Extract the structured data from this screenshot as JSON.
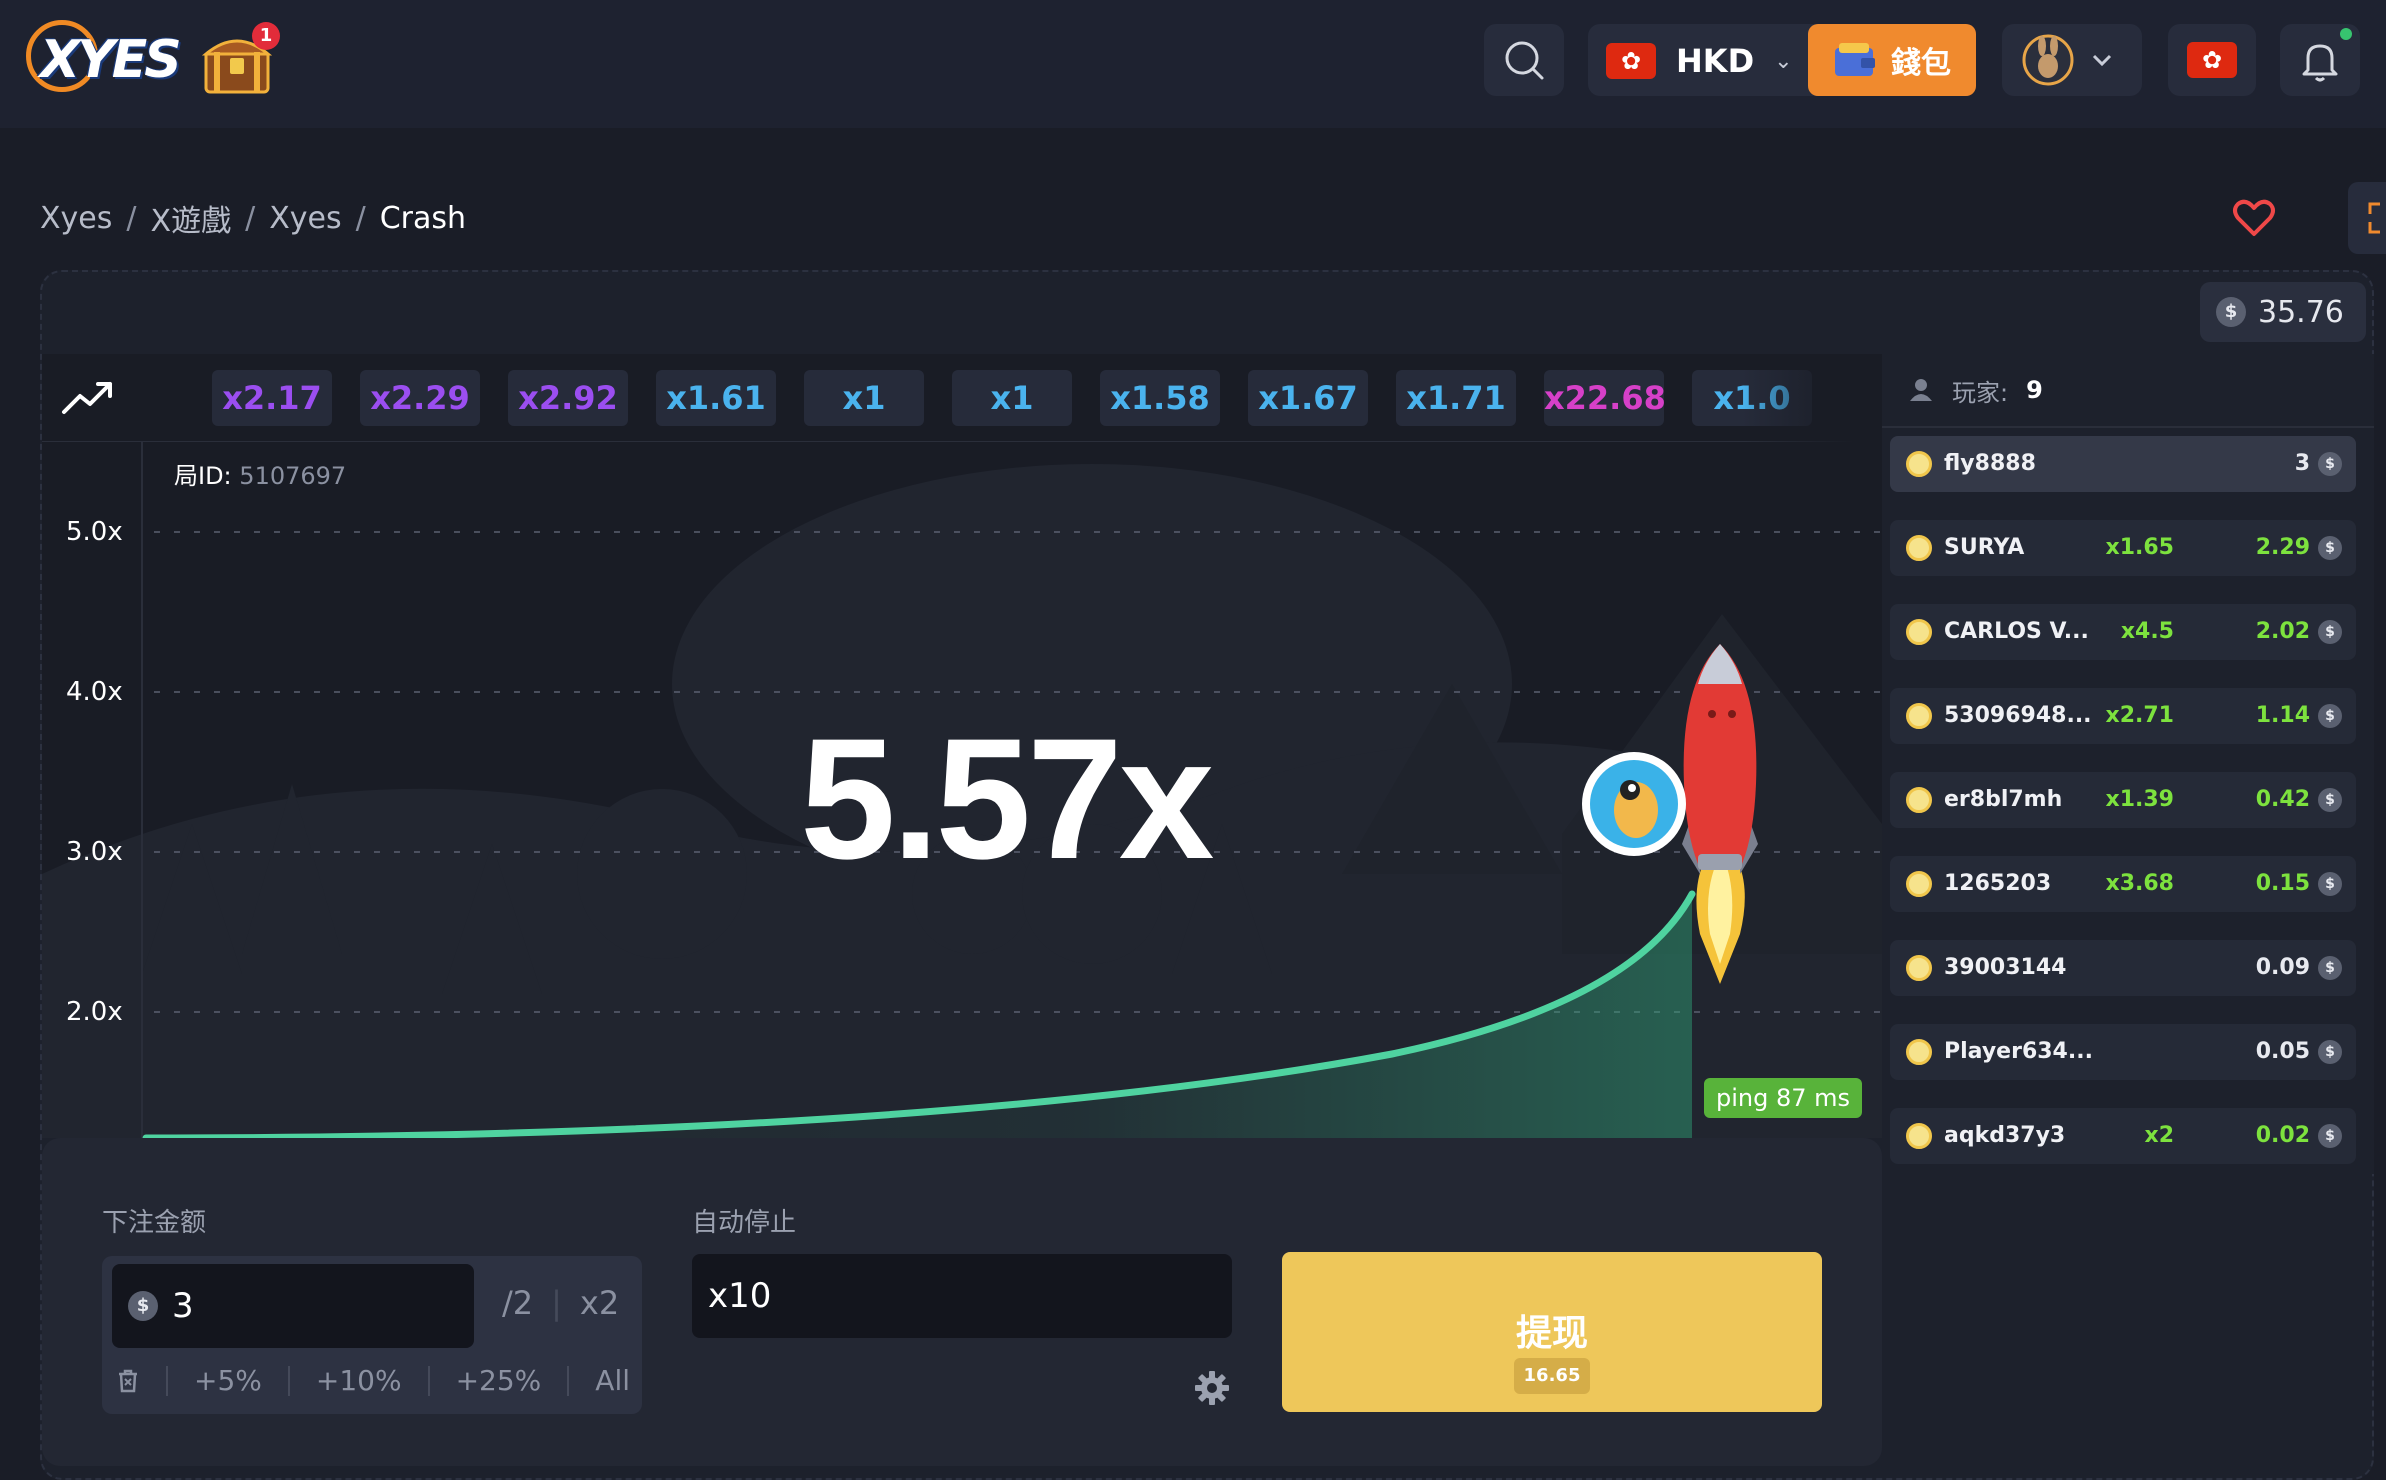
{
  "header": {
    "logo_text": "XYES",
    "chest_badge": "1",
    "currency": {
      "code": "HKD"
    },
    "wallet_label": "錢包"
  },
  "breadcrumb": {
    "items": [
      "Xyes",
      "X遊戲",
      "Xyes"
    ],
    "current": "Crash",
    "separator": "/"
  },
  "game": {
    "balance": "35.76",
    "history": [
      {
        "value": "x2.17",
        "color": "#9b4ef0"
      },
      {
        "value": "x2.29",
        "color": "#9b4ef0"
      },
      {
        "value": "x2.92",
        "color": "#9b4ef0"
      },
      {
        "value": "x1.61",
        "color": "#4ab3ee"
      },
      {
        "value": "x1",
        "color": "#4ab3ee"
      },
      {
        "value": "x1",
        "color": "#4ab3ee"
      },
      {
        "value": "x1.58",
        "color": "#4ab3ee"
      },
      {
        "value": "x1.67",
        "color": "#4ab3ee"
      },
      {
        "value": "x1.71",
        "color": "#4ab3ee"
      },
      {
        "value": "x22.68",
        "color": "#d640c8"
      },
      {
        "value": "x1.0",
        "color": "#4ab3ee"
      }
    ],
    "round_id_label": "局ID:",
    "round_id": "5107697",
    "current_multiplier": "5.57x",
    "ping": "ping 87 ms",
    "y_axis": [
      "5.0x",
      "4.0x",
      "3.0x",
      "2.0x"
    ],
    "curve_color": "#4fd3a0"
  },
  "players": {
    "label": "玩家:",
    "count": "9",
    "rows": [
      {
        "name": "fly8888",
        "mult": "",
        "amount": "3",
        "win": false
      },
      {
        "name": "SURYA",
        "mult": "x1.65",
        "amount": "2.29",
        "win": true
      },
      {
        "name": "CARLOS V...",
        "mult": "x4.5",
        "amount": "2.02",
        "win": true
      },
      {
        "name": "53096948...",
        "mult": "x2.71",
        "amount": "1.14",
        "win": true
      },
      {
        "name": "er8bl7mh",
        "mult": "x1.39",
        "amount": "0.42",
        "win": true
      },
      {
        "name": "1265203",
        "mult": "x3.68",
        "amount": "0.15",
        "win": true
      },
      {
        "name": "39003144",
        "mult": "",
        "amount": "0.09",
        "win": false
      },
      {
        "name": "Player634...",
        "mult": "",
        "amount": "0.05",
        "win": false
      },
      {
        "name": "aqkd37y3",
        "mult": "x2",
        "amount": "0.02",
        "win": true
      }
    ]
  },
  "bet": {
    "amount_label": "下注金额",
    "amount": "3",
    "half": "/2",
    "double": "x2",
    "quick": [
      "+5%",
      "+10%",
      "+25%",
      "All"
    ],
    "auto_stop_label": "自动停止",
    "auto_stop_value": "x10",
    "cashout_label": "提现",
    "cashout_amount": "16.65"
  }
}
